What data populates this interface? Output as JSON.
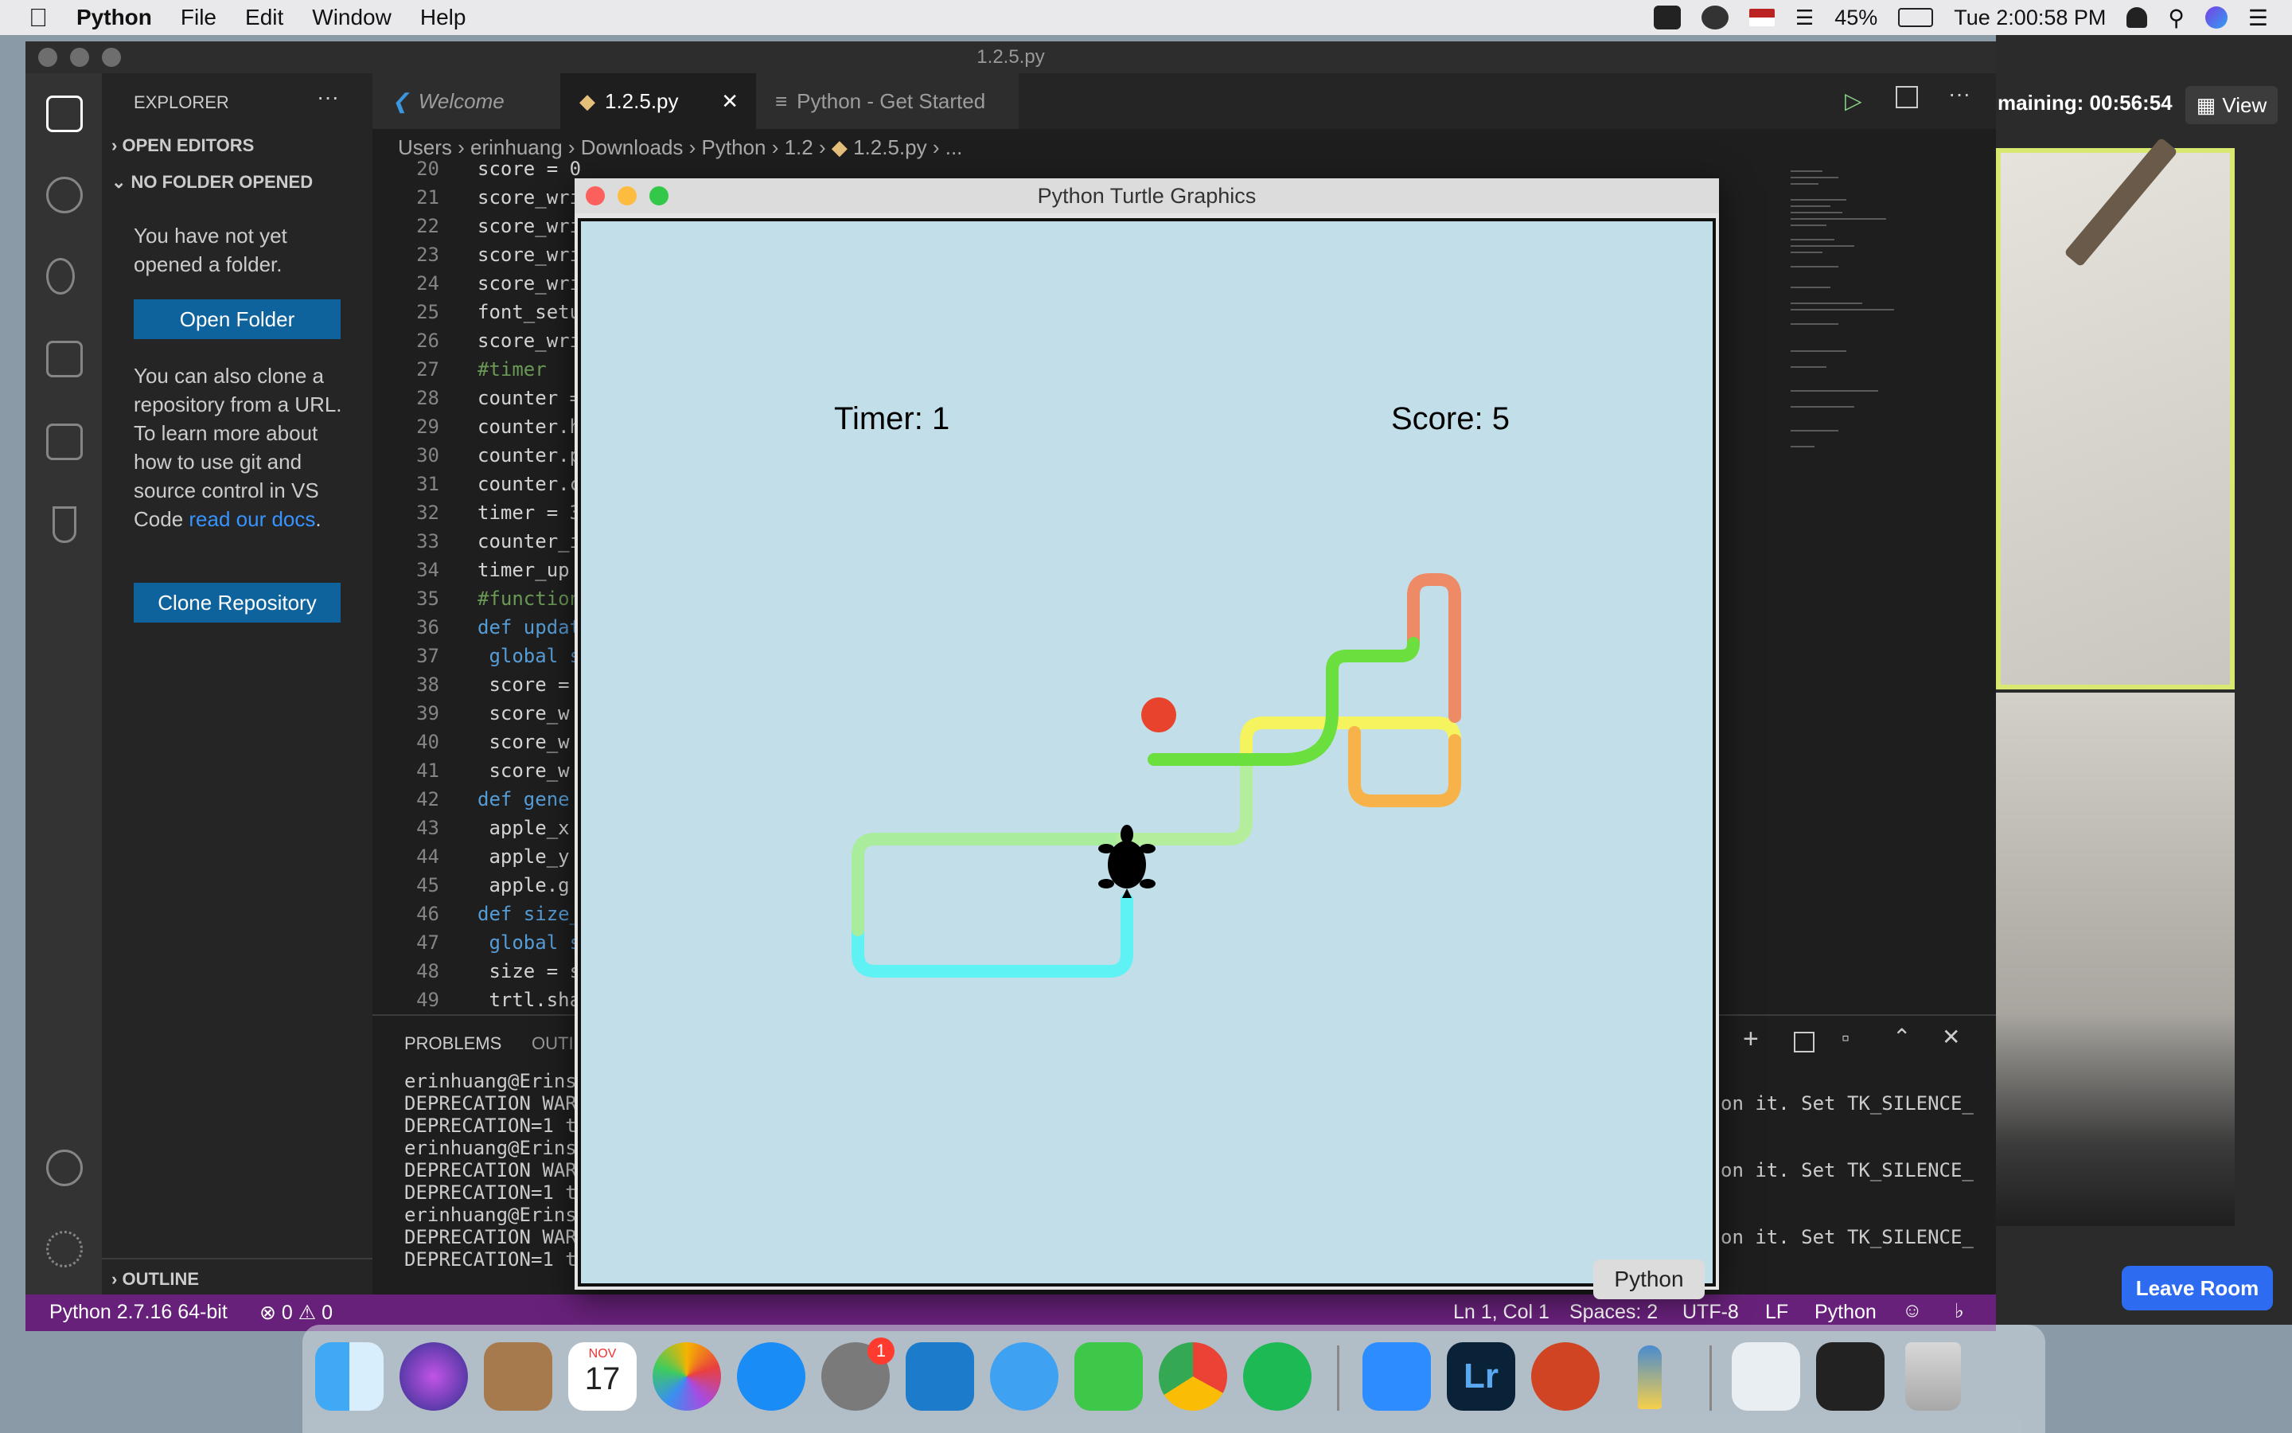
{
  "menubar": {
    "app": "Python",
    "items": [
      "File",
      "Edit",
      "Window",
      "Help"
    ],
    "battery": "45%",
    "clock": "Tue 2:00:58 PM"
  },
  "zoom": {
    "time_remaining": "maining: 00:56:54",
    "view_label": "View",
    "leave_label": "Leave Room"
  },
  "vscode": {
    "window_title": "1.2.5.py",
    "tabs": [
      {
        "label": "Welcome",
        "icon": "vscode-icon"
      },
      {
        "label": "1.2.5.py",
        "icon": "python-file-icon"
      },
      {
        "label": "Python - Get Started",
        "icon": "doc-icon"
      }
    ],
    "breadcrumb": [
      "Users",
      "erinhuang",
      "Downloads",
      "Python",
      "1.2",
      "1.2.5.py",
      "..."
    ],
    "explorer": {
      "title": "EXPLORER",
      "open_editors": "OPEN EDITORS",
      "no_folder": "NO FOLDER OPENED",
      "msg1": "You have not yet opened a folder.",
      "open_folder": "Open Folder",
      "msg2a": "You can also clone a repository from a URL. To learn more about how to use git and source control in VS Code ",
      "msg2_link": "read our docs",
      "msg2b": ".",
      "clone": "Clone Repository",
      "outline": "OUTLINE"
    },
    "code_lines": [
      {
        "n": "20",
        "text": "score = 0"
      },
      {
        "n": "21",
        "text": "score_wri"
      },
      {
        "n": "22",
        "text": "score_wri"
      },
      {
        "n": "23",
        "text": "score_wri"
      },
      {
        "n": "24",
        "text": "score_wri"
      },
      {
        "n": "25",
        "text": "font_setu"
      },
      {
        "n": "26",
        "text": "score_wri"
      },
      {
        "n": "27",
        "text": "#timer"
      },
      {
        "n": "28",
        "text": "counter ="
      },
      {
        "n": "29",
        "text": "counter.h"
      },
      {
        "n": "30",
        "text": "counter.p"
      },
      {
        "n": "31",
        "text": "counter.c"
      },
      {
        "n": "32",
        "text": "timer = 3"
      },
      {
        "n": "33",
        "text": "counter_i"
      },
      {
        "n": "34",
        "text": "timer_up"
      },
      {
        "n": "35",
        "text": "#function"
      },
      {
        "n": "36",
        "text": "def updat"
      },
      {
        "n": "37",
        "text": " global s"
      },
      {
        "n": "38",
        "text": " score ="
      },
      {
        "n": "39",
        "text": " score_w"
      },
      {
        "n": "40",
        "text": " score_w"
      },
      {
        "n": "41",
        "text": " score_w"
      },
      {
        "n": "42",
        "text": "def gene"
      },
      {
        "n": "43",
        "text": " apple_x"
      },
      {
        "n": "44",
        "text": " apple_y"
      },
      {
        "n": "45",
        "text": " apple.g"
      },
      {
        "n": "46",
        "text": "def size_"
      },
      {
        "n": "47",
        "text": " global s"
      },
      {
        "n": "48",
        "text": " size = s"
      },
      {
        "n": "49",
        "text": " trtl.sha"
      }
    ],
    "panel_tabs": [
      "PROBLEMS",
      "OUTI"
    ],
    "terminal_left": [
      "erinhuang@Erins",
      "DEPRECATION WAR",
      "DEPRECATION=1 t",
      "erinhuang@Erins",
      "DEPRECATION WAR",
      "DEPRECATION=1 t",
      "erinhuang@Erins",
      "DEPRECATION WAR",
      "DEPRECATION=1 t"
    ],
    "terminal_right": [
      "on it. Set TK_SILENCE_",
      "on it. Set TK_SILENCE_",
      "on it. Set TK_SILENCE_"
    ],
    "status": {
      "interpreter": "Python 2.7.16 64-bit",
      "errors": "0",
      "warnings": "0",
      "position": "Ln 1, Col 1",
      "spaces": "Spaces: 2",
      "encoding": "UTF-8",
      "eol": "LF",
      "language": "Python"
    }
  },
  "turtle": {
    "title": "Python Turtle Graphics",
    "timer": "Timer: 1",
    "score": "Score: 5",
    "colors": {
      "background": "#c2dfe9",
      "apple": "#e8432c"
    }
  },
  "dock": {
    "tooltip": "Python",
    "calendar_month": "NOV",
    "calendar_day": "17",
    "badge": "1",
    "apps": [
      "finder",
      "siri",
      "contacts",
      "calendar",
      "photos",
      "app-store",
      "system-preferences",
      "vscode",
      "messages",
      "facetime",
      "chrome",
      "spotify",
      "zoom",
      "lightroom",
      "powerpoint",
      "python-launcher",
      "downloads",
      "screenshot",
      "trash"
    ]
  }
}
